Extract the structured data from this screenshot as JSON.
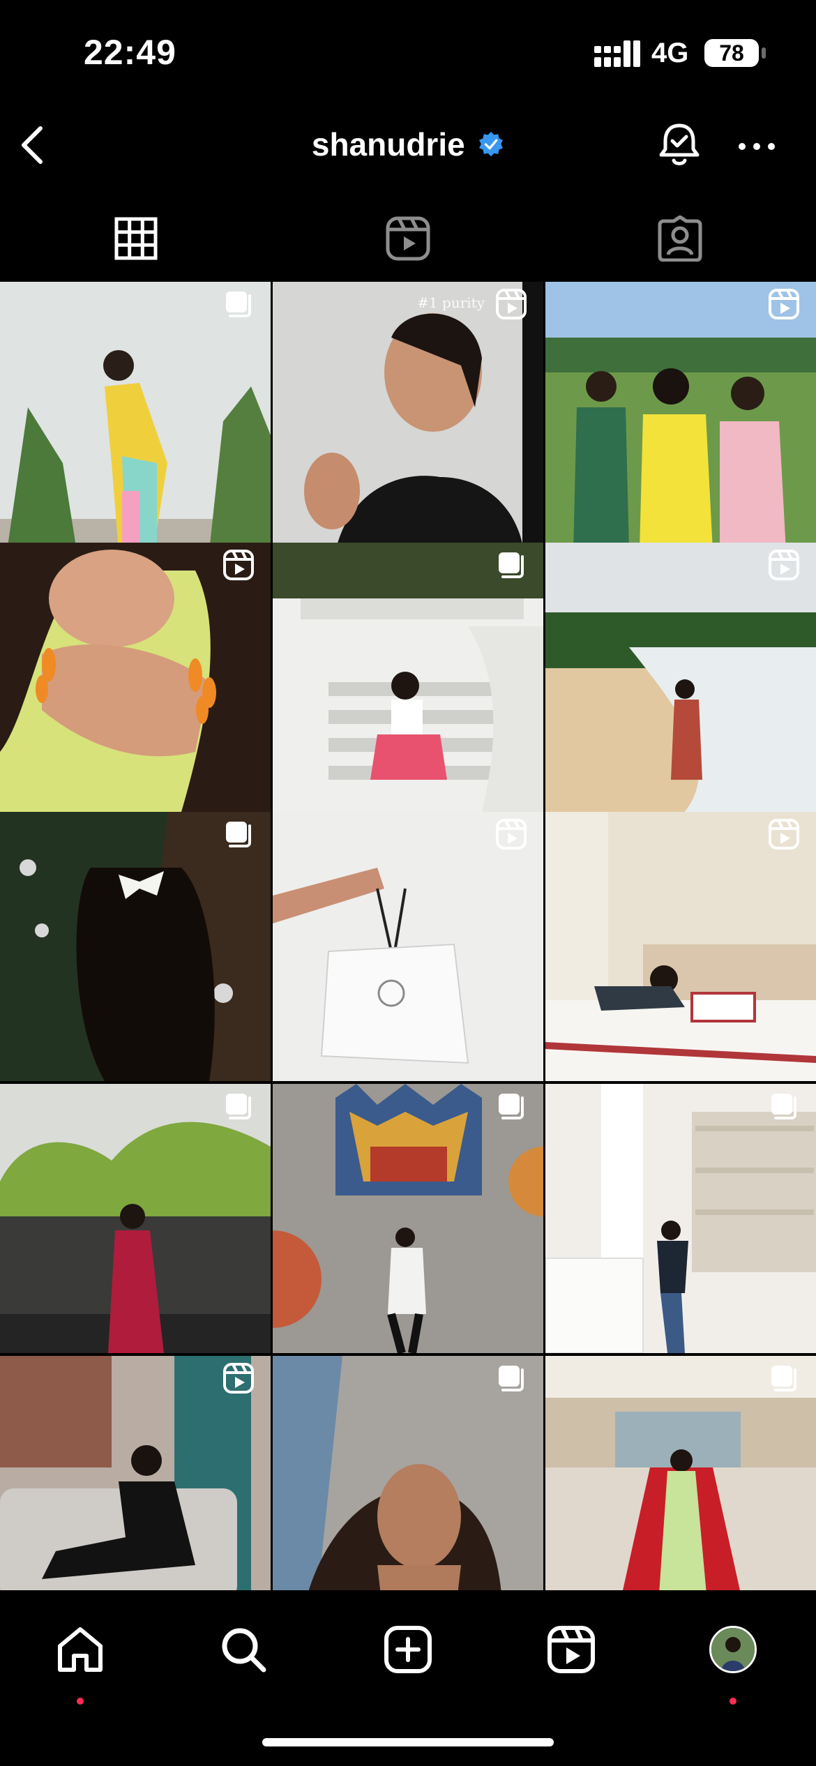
{
  "status_bar": {
    "time": "22:49",
    "network": "4G",
    "battery": "78"
  },
  "header": {
    "username": "shanudrie",
    "verified_icon": "verified-badge-icon",
    "accent": "#3897f0"
  },
  "tabs": [
    {
      "name": "posts-grid",
      "icon": "grid-icon",
      "active": true
    },
    {
      "name": "reels",
      "icon": "reels-icon",
      "active": false
    },
    {
      "name": "tagged",
      "icon": "tagged-person-icon",
      "active": false
    }
  ],
  "grid": {
    "posts": [
      {
        "type": "carousel",
        "caption": ""
      },
      {
        "type": "reel",
        "caption": "#1 purity"
      },
      {
        "type": "reel",
        "caption": ""
      },
      {
        "type": "reel",
        "caption": ""
      },
      {
        "type": "carousel",
        "caption": ""
      },
      {
        "type": "reel",
        "caption": ""
      },
      {
        "type": "carousel",
        "caption": ""
      },
      {
        "type": "reel",
        "caption": ""
      },
      {
        "type": "reel",
        "caption": ""
      },
      {
        "type": "carousel",
        "caption": ""
      },
      {
        "type": "carousel",
        "caption": ""
      },
      {
        "type": "carousel",
        "caption": ""
      },
      {
        "type": "reel",
        "caption": ""
      },
      {
        "type": "carousel",
        "caption": ""
      },
      {
        "type": "carousel",
        "caption": ""
      }
    ]
  },
  "bottom_nav": [
    {
      "name": "home",
      "icon": "home-icon",
      "notification_dot": true
    },
    {
      "name": "search",
      "icon": "search-icon",
      "notification_dot": false
    },
    {
      "name": "create",
      "icon": "plus-square-icon",
      "notification_dot": false
    },
    {
      "name": "reels",
      "icon": "reels-icon",
      "notification_dot": false
    },
    {
      "name": "profile",
      "icon": "profile-avatar",
      "notification_dot": true
    }
  ],
  "colors": {
    "background": "#000000",
    "notification": "#ff2d55"
  }
}
